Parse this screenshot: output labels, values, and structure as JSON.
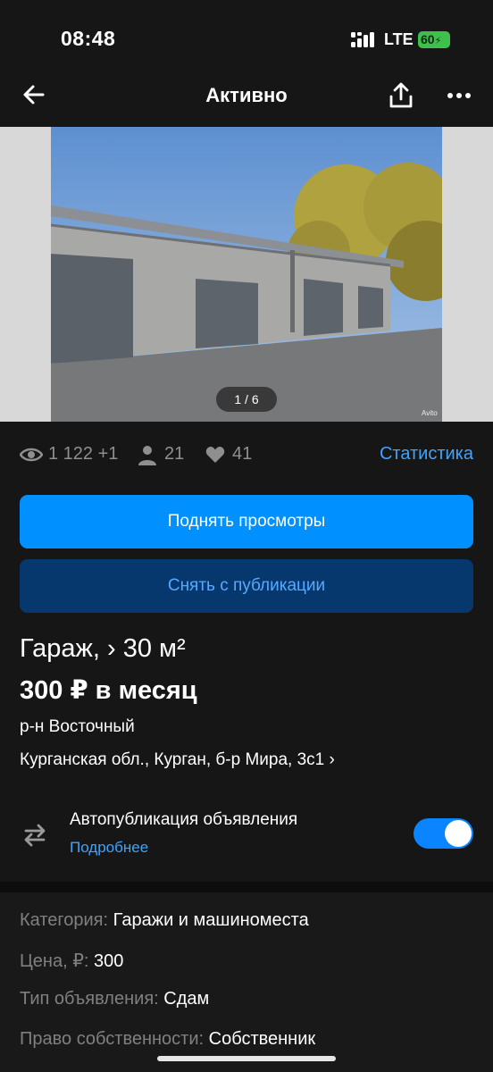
{
  "status_bar": {
    "time": "08:48",
    "network": "LTE",
    "battery": "60"
  },
  "header": {
    "title": "Активно"
  },
  "gallery": {
    "counter": "1 / 6",
    "watermark": "Avito"
  },
  "stats": {
    "views": "1 122 +1",
    "contacts": "21",
    "favorites": "41",
    "link": "Статистика"
  },
  "actions": {
    "raise": "Поднять просмотры",
    "unpublish": "Снять с публикации"
  },
  "listing": {
    "title": "Гараж, › 30 м²",
    "price": "300 ₽ в месяц",
    "district": "р-н Восточный",
    "address": "Курганская обл., Курган, б-р Мира, 3с1 ›"
  },
  "autopublish": {
    "label": "Автопубликация объявления",
    "more": "Подробнее",
    "enabled": true
  },
  "details": {
    "category_key": "Категория:",
    "category_val": "Гаражи и машиноместа",
    "price_key": "Цена, ₽:",
    "price_val": "300",
    "type_key": "Тип объявления:",
    "type_val": "Сдам",
    "owner_key": "Право собственности:",
    "owner_val": "Собственник"
  },
  "colors": {
    "accent": "#0090ff",
    "link": "#3fa4ff",
    "background": "#161616"
  }
}
